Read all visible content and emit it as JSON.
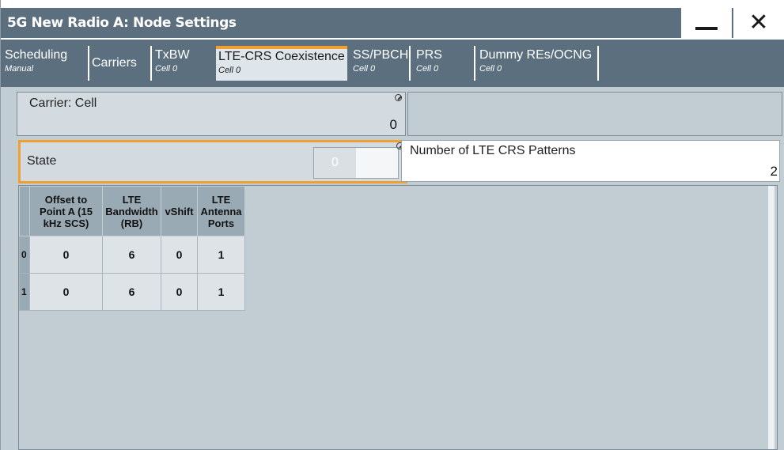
{
  "window": {
    "title": "5G New Radio A: Node Settings",
    "minimize_label": "—",
    "close_label": "✕"
  },
  "tabs": [
    {
      "label": "Scheduling",
      "sub": "Manual"
    },
    {
      "label": "Carriers",
      "sub": ""
    },
    {
      "label": "TxBW",
      "sub": "Cell 0"
    },
    {
      "label": "LTE-CRS Coexistence",
      "sub": "Cell 0",
      "active": true
    },
    {
      "label": "SS/PBCH",
      "sub": "Cell 0"
    },
    {
      "label": "PRS",
      "sub": "Cell 0"
    },
    {
      "label": "Dummy REs/OCNG",
      "sub": "Cell 0"
    }
  ],
  "carrier": {
    "label": "Carrier: Cell",
    "value": "0"
  },
  "state": {
    "label": "State",
    "toggle_on": "0"
  },
  "patterns": {
    "label": "Number of LTE CRS Patterns",
    "value": "2"
  },
  "table": {
    "columns": [
      "Offset to Point A (15 kHz SCS)",
      "LTE Bandwidth (RB)",
      "vShift",
      "LTE Antenna Ports"
    ],
    "rows": [
      {
        "index": "0",
        "cells": [
          "0",
          "6",
          "0",
          "1"
        ]
      },
      {
        "index": "1",
        "cells": [
          "0",
          "6",
          "0",
          "1"
        ]
      }
    ]
  },
  "colors": {
    "titlebar": "#5b6f7e",
    "accent": "#f0a030",
    "panel": "#c2ccd3"
  }
}
